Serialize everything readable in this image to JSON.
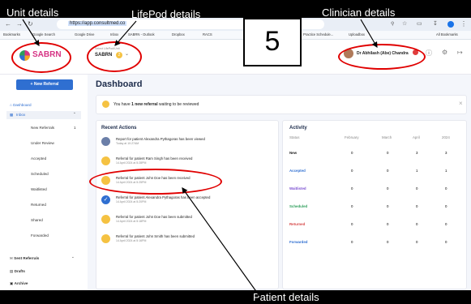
{
  "annotations": {
    "unit_details": "Unit details",
    "lifepod_details": "LifePod details",
    "clinician_details": "Clinician details",
    "patient_details": "Patient details",
    "step_number": "5"
  },
  "browser": {
    "url": "https://app.consultmed.co",
    "bookmarks": [
      "Bookmarks",
      "Google Search",
      "Google Drive",
      "Inbox",
      "SABRN - Outlook",
      "Dropbox",
      "RACS",
      "ANZ AU",
      "Practice Schedule...",
      "Uploadbox"
    ],
    "all_bookmarks": "All Bookmarks"
  },
  "header": {
    "logo_text": "SABRN",
    "lifepod_caption": "Select LifePod/Unit",
    "lifepod_value": "SABRN",
    "lifepod_badge": "2",
    "clinician_name": "Dr Abhilash (Abe) Chandra"
  },
  "sidebar": {
    "new_referral": "+ New Referral",
    "dashboard": "Dashboard",
    "inbox": "Inbox",
    "sub_items": [
      "New Referrals",
      "Under Review",
      "Accepted",
      "Scheduled",
      "Waitlisted",
      "Returned",
      "Shared",
      "Forwarded"
    ],
    "new_referrals_count": "1",
    "sent_referrals": "Sent Referrals",
    "drafts": "Drafts",
    "archive": "Archive"
  },
  "main": {
    "title": "Dashboard",
    "notice_prefix": "You have ",
    "notice_bold": "1 new referral",
    "notice_suffix": " waiting to be reviewed",
    "recent_actions_title": "Recent Actions",
    "actions": [
      {
        "text": "Report for patient Alexandra Pythagoras has been viewed",
        "date": "Today at 10:27AM",
        "color": "#6b7fa8"
      },
      {
        "text": "Referral for patient Ram Singh has been received",
        "date": "14 April 2024 at 5:28PM",
        "color": "#f5c242"
      },
      {
        "text": "Referral for patient John Doe has been received",
        "date": "14 April 2024 at 5:25PM",
        "color": "#f5c242"
      },
      {
        "text": "Referral for patient Alexandra Pythagoras has been accepted",
        "date": "14 April 2024 at 5:20PM",
        "color": "#2f6fd1"
      },
      {
        "text": "Referral for patient John Doe has been submitted",
        "date": "14 April 2024 at 5:18PM",
        "color": "#f5c242"
      },
      {
        "text": "Referral for patient John Smith has been submitted",
        "date": "14 April 2024 at 5:16PM",
        "color": "#f5c242"
      }
    ],
    "activity_title": "Activity",
    "activity_headers": [
      "Status",
      "February",
      "March",
      "April",
      "2024"
    ],
    "activity_rows": [
      {
        "label": "New",
        "values": [
          "0",
          "0",
          "3",
          "3"
        ],
        "color": "#222222"
      },
      {
        "label": "Accepted",
        "values": [
          "0",
          "0",
          "1",
          "1"
        ],
        "color": "#2f6fd1"
      },
      {
        "label": "Waitlisted",
        "values": [
          "0",
          "0",
          "0",
          "0"
        ],
        "color": "#7b4fd1"
      },
      {
        "label": "Scheduled",
        "values": [
          "0",
          "0",
          "0",
          "0"
        ],
        "color": "#2e9e5b"
      },
      {
        "label": "Returned",
        "values": [
          "0",
          "0",
          "0",
          "0"
        ],
        "color": "#d64545"
      },
      {
        "label": "Forwarded",
        "values": [
          "0",
          "0",
          "0",
          "0"
        ],
        "color": "#2f6fd1"
      }
    ]
  }
}
